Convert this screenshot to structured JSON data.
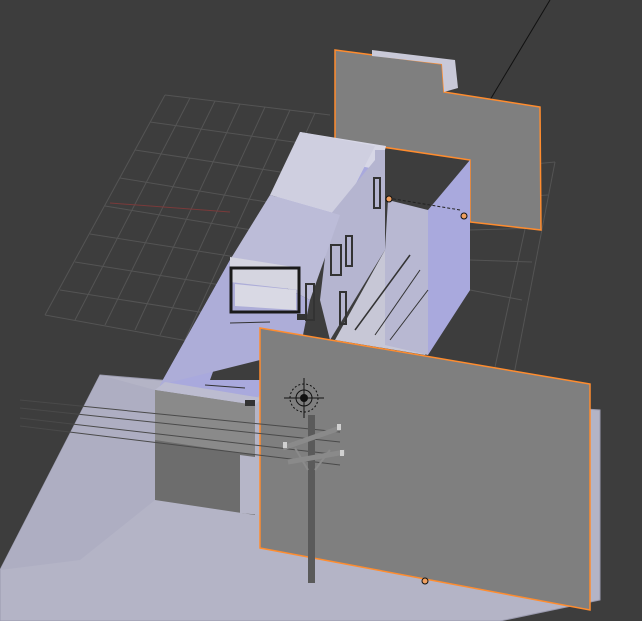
{
  "viewport": {
    "kind": "3d-viewport",
    "background_color": "#3d3d3d",
    "grid_color": "#535353",
    "x_axis_color": "#7a3a3a",
    "y_axis_color": "#3a7a3a"
  },
  "scene": {
    "ground_color": "#b4b4c6",
    "building_light": "#d7d7e6",
    "building_mid": "#b7b7cf",
    "building_side": "#a9a9dd",
    "building_dark": "#6b6b6b",
    "plane_color": "#7f7f7f",
    "selection_outline": "#ff8c2e",
    "origin_point_color": "#f0a060",
    "pole_color": "#5a5a5a",
    "wire_color": "#4a4a4a"
  },
  "objects": [
    {
      "name": "ground-plane",
      "selected": false
    },
    {
      "name": "building",
      "selected": false
    },
    {
      "name": "back-reference-image",
      "selected": true
    },
    {
      "name": "front-reference-image",
      "selected": true
    },
    {
      "name": "utility-pole",
      "selected": false
    },
    {
      "name": "light-lamp",
      "selected": false
    }
  ]
}
